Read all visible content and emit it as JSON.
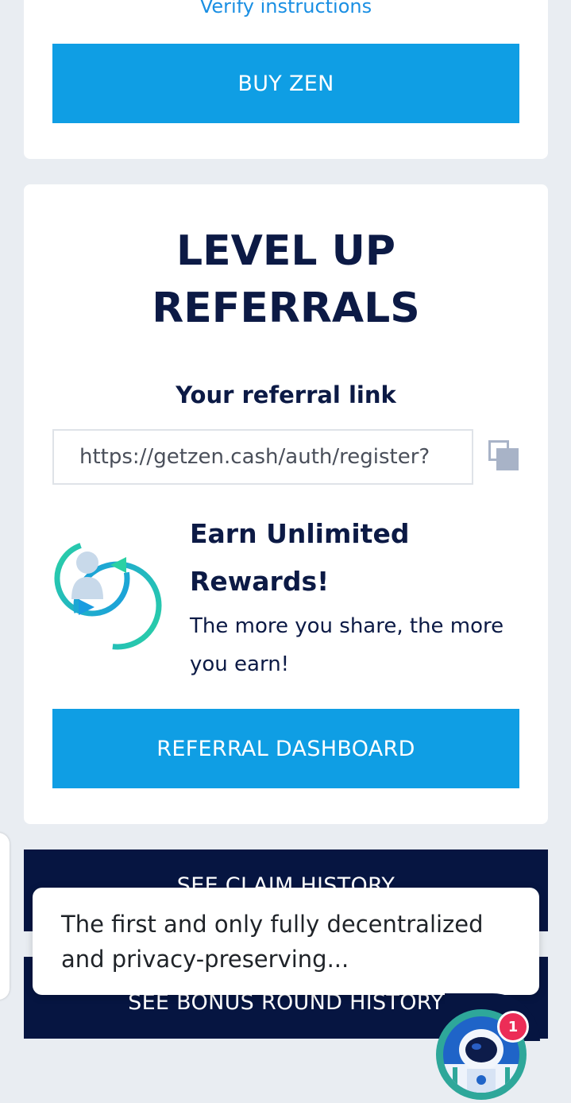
{
  "top_card": {
    "verify_link": "Verify instructions",
    "buy_button": "BUY ZEN"
  },
  "referral": {
    "title_line1": "LEVEL UP",
    "title_line2": "REFERRALS",
    "subtitle": "Your referral link",
    "link_value": "https://getzen.cash/auth/register?",
    "copy_icon": "copy-icon",
    "graphic_icon": "referral-cycle-icon",
    "earn_title": "Earn Unlimited Rewards!",
    "earn_text": "The more you share, the more you earn!",
    "dashboard_button": "REFERRAL DASHBOARD"
  },
  "history": {
    "claim_button": "SEE CLAIM HISTORY",
    "bonus_button": "SEE BONUS ROUND HISTORY"
  },
  "chat": {
    "message": "The first and only fully decentralized and privacy-preserving...",
    "badge_count": "1",
    "avatar_icon": "astronaut-avatar-icon"
  },
  "colors": {
    "primary": "#0f9ee4",
    "dark": "#061541",
    "heading": "#0c1a45",
    "link": "#1a8fe3",
    "badge": "#ec2d57"
  }
}
